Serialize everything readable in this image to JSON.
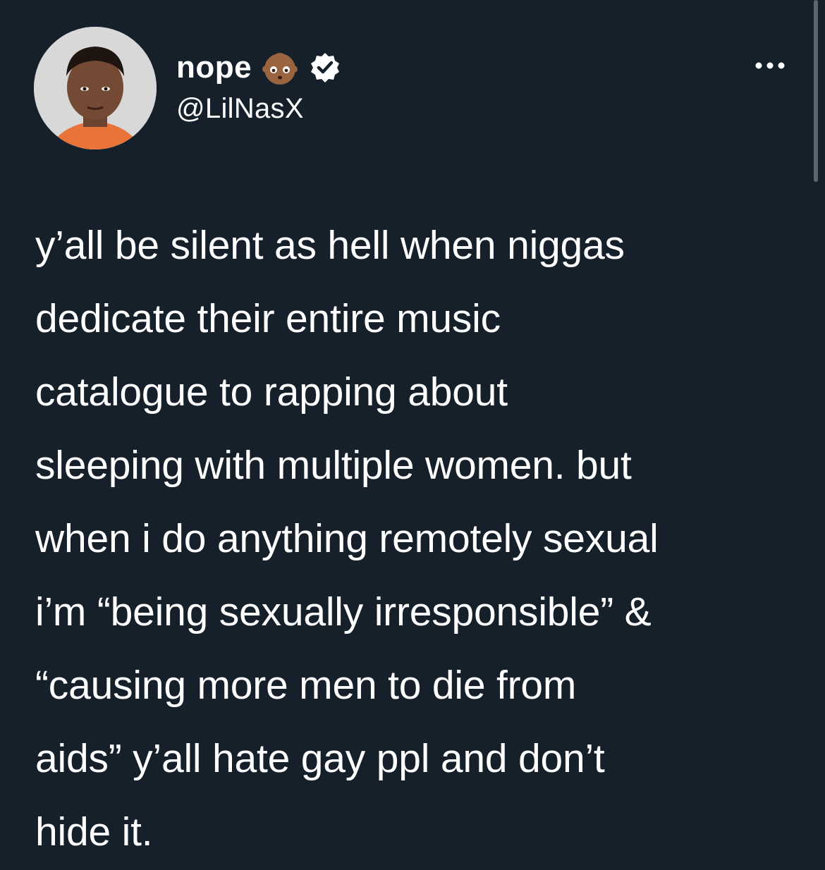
{
  "tweet": {
    "author": {
      "display_name": "nope",
      "name_emoji": "baby-face-emoji",
      "verified_icon": "verified-badge-icon",
      "handle": "@LilNasX"
    },
    "menu_icon": "more-options-icon",
    "text": "y’all be silent as hell when niggas\ndedicate their entire music\ncatalogue to rapping about\nsleeping with multiple women. but\nwhen i do anything remotely sexual\ni’m “being sexually irresponsible” &\n“causing more men to die from\naids” y’all hate gay ppl and don’t\nhide it."
  },
  "colors": {
    "background": "#15202b",
    "text": "#ffffff",
    "verified_badge": "#ffffff",
    "scrollbar": "#5b6670"
  }
}
